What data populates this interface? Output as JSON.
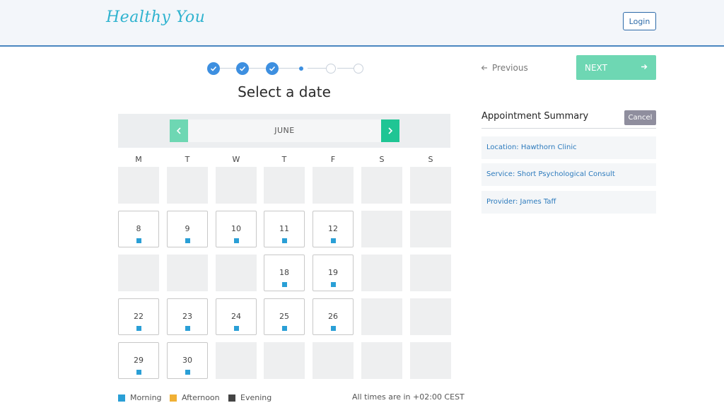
{
  "header": {
    "logo": "Healthy You",
    "login_label": "Login"
  },
  "stepper": {
    "steps": [
      "done",
      "done",
      "done",
      "current",
      "todo",
      "todo"
    ]
  },
  "page_title": "Select a date",
  "calendar": {
    "month": "JUNE",
    "prev_icon": "chevron-left-icon",
    "next_icon": "chevron-right-icon",
    "weekdays": [
      "M",
      "T",
      "W",
      "T",
      "F",
      "S",
      "S"
    ],
    "weeks": [
      [
        null,
        null,
        null,
        null,
        null,
        null,
        null
      ],
      [
        "8",
        "9",
        "10",
        "11",
        "12",
        null,
        null
      ],
      [
        null,
        null,
        null,
        "18",
        "19",
        null,
        null
      ],
      [
        "22",
        "23",
        "24",
        "25",
        "26",
        null,
        null
      ],
      [
        "29",
        "30",
        null,
        null,
        null,
        null,
        null
      ]
    ]
  },
  "legend": [
    {
      "label": "Morning",
      "color": "#2a9fd6"
    },
    {
      "label": "Afternoon",
      "color": "#f0b035"
    },
    {
      "label": "Evening",
      "color": "#444444"
    }
  ],
  "timezone_note": "All times are in +02:00 CEST",
  "nav": {
    "previous_label": "Previous",
    "next_label": "NEXT"
  },
  "summary": {
    "title": "Appointment Summary",
    "cancel_label": "Cancel",
    "items": [
      "Location: Hawthorn Clinic",
      "Service: Short Psychological Consult",
      "Provider: James Taff"
    ]
  }
}
